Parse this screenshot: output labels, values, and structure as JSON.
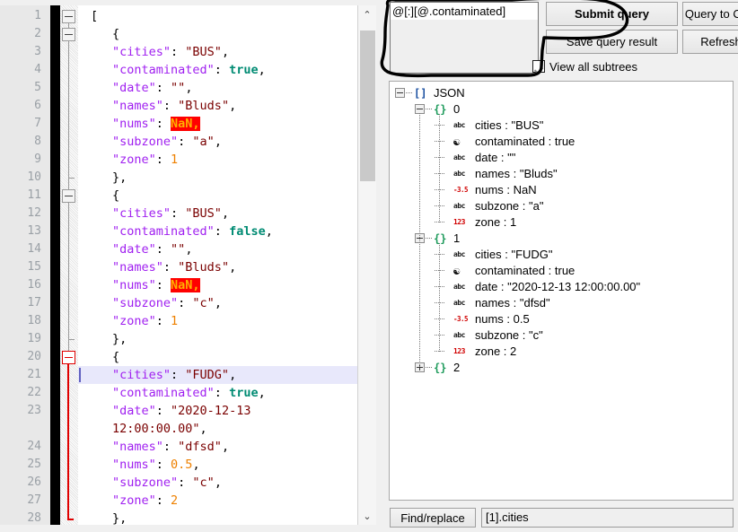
{
  "editor": {
    "name": "json-text-editor",
    "lines": [
      {
        "num": "1",
        "tokens": [
          {
            "t": "[",
            "c": "p"
          }
        ],
        "indent": 0
      },
      {
        "num": "2",
        "tokens": [
          {
            "t": "{",
            "c": "p"
          }
        ],
        "indent": 1
      },
      {
        "num": "3",
        "tokens": [
          {
            "t": "\"cities\"",
            "c": "k"
          },
          {
            "t": ": ",
            "c": "p"
          },
          {
            "t": "\"BUS\"",
            "c": "s"
          },
          {
            "t": ",",
            "c": "p"
          }
        ],
        "indent": 1
      },
      {
        "num": "4",
        "tokens": [
          {
            "t": "\"contaminated\"",
            "c": "k"
          },
          {
            "t": ": ",
            "c": "p"
          },
          {
            "t": "true",
            "c": "b"
          },
          {
            "t": ",",
            "c": "p"
          }
        ],
        "indent": 1
      },
      {
        "num": "5",
        "tokens": [
          {
            "t": "\"date\"",
            "c": "k"
          },
          {
            "t": ": ",
            "c": "p"
          },
          {
            "t": "\"\"",
            "c": "s"
          },
          {
            "t": ",",
            "c": "p"
          }
        ],
        "indent": 1
      },
      {
        "num": "6",
        "tokens": [
          {
            "t": "\"names\"",
            "c": "k"
          },
          {
            "t": ": ",
            "c": "p"
          },
          {
            "t": "\"Bluds\"",
            "c": "s"
          },
          {
            "t": ",",
            "c": "p"
          }
        ],
        "indent": 1
      },
      {
        "num": "7",
        "tokens": [
          {
            "t": "\"nums\"",
            "c": "k"
          },
          {
            "t": ": ",
            "c": "p"
          },
          {
            "t": "NaN,",
            "c": "nan"
          }
        ],
        "indent": 1
      },
      {
        "num": "8",
        "tokens": [
          {
            "t": "\"subzone\"",
            "c": "k"
          },
          {
            "t": ": ",
            "c": "p"
          },
          {
            "t": "\"a\"",
            "c": "s"
          },
          {
            "t": ",",
            "c": "p"
          }
        ],
        "indent": 1
      },
      {
        "num": "9",
        "tokens": [
          {
            "t": "\"zone\"",
            "c": "k"
          },
          {
            "t": ": ",
            "c": "p"
          },
          {
            "t": "1",
            "c": "n"
          }
        ],
        "indent": 1
      },
      {
        "num": "10",
        "tokens": [
          {
            "t": "},",
            "c": "p"
          }
        ],
        "indent": 1
      },
      {
        "num": "11",
        "tokens": [
          {
            "t": "{",
            "c": "p"
          }
        ],
        "indent": 1
      },
      {
        "num": "12",
        "tokens": [
          {
            "t": "\"cities\"",
            "c": "k"
          },
          {
            "t": ": ",
            "c": "p"
          },
          {
            "t": "\"BUS\"",
            "c": "s"
          },
          {
            "t": ",",
            "c": "p"
          }
        ],
        "indent": 1
      },
      {
        "num": "13",
        "tokens": [
          {
            "t": "\"contaminated\"",
            "c": "k"
          },
          {
            "t": ": ",
            "c": "p"
          },
          {
            "t": "false",
            "c": "b"
          },
          {
            "t": ",",
            "c": "p"
          }
        ],
        "indent": 1
      },
      {
        "num": "14",
        "tokens": [
          {
            "t": "\"date\"",
            "c": "k"
          },
          {
            "t": ": ",
            "c": "p"
          },
          {
            "t": "\"\"",
            "c": "s"
          },
          {
            "t": ",",
            "c": "p"
          }
        ],
        "indent": 1
      },
      {
        "num": "15",
        "tokens": [
          {
            "t": "\"names\"",
            "c": "k"
          },
          {
            "t": ": ",
            "c": "p"
          },
          {
            "t": "\"Bluds\"",
            "c": "s"
          },
          {
            "t": ",",
            "c": "p"
          }
        ],
        "indent": 1
      },
      {
        "num": "16",
        "tokens": [
          {
            "t": "\"nums\"",
            "c": "k"
          },
          {
            "t": ": ",
            "c": "p"
          },
          {
            "t": "NaN,",
            "c": "nan"
          }
        ],
        "indent": 1
      },
      {
        "num": "17",
        "tokens": [
          {
            "t": "\"subzone\"",
            "c": "k"
          },
          {
            "t": ": ",
            "c": "p"
          },
          {
            "t": "\"c\"",
            "c": "s"
          },
          {
            "t": ",",
            "c": "p"
          }
        ],
        "indent": 1
      },
      {
        "num": "18",
        "tokens": [
          {
            "t": "\"zone\"",
            "c": "k"
          },
          {
            "t": ": ",
            "c": "p"
          },
          {
            "t": "1",
            "c": "n"
          }
        ],
        "indent": 1
      },
      {
        "num": "19",
        "tokens": [
          {
            "t": "},",
            "c": "p"
          }
        ],
        "indent": 1
      },
      {
        "num": "20",
        "tokens": [
          {
            "t": "{",
            "c": "p"
          }
        ],
        "indent": 1
      },
      {
        "num": "21",
        "tokens": [
          {
            "t": "\"cities\"",
            "c": "k"
          },
          {
            "t": ": ",
            "c": "p"
          },
          {
            "t": "\"FUDG\"",
            "c": "s"
          },
          {
            "t": ",",
            "c": "p"
          }
        ],
        "indent": 1,
        "current": true
      },
      {
        "num": "22",
        "tokens": [
          {
            "t": "\"contaminated\"",
            "c": "k"
          },
          {
            "t": ": ",
            "c": "p"
          },
          {
            "t": "true",
            "c": "b"
          },
          {
            "t": ",",
            "c": "p"
          }
        ],
        "indent": 1
      },
      {
        "num": "23",
        "tokens": [
          {
            "t": "\"date\"",
            "c": "k"
          },
          {
            "t": ": ",
            "c": "p"
          },
          {
            "t": "\"2020-12-13",
            "c": "s"
          }
        ],
        "indent": 1
      },
      {
        "num": "",
        "tokens": [
          {
            "t": "12:00:00.00\"",
            "c": "s"
          },
          {
            "t": ",",
            "c": "p"
          }
        ],
        "indent": 1
      },
      {
        "num": "24",
        "tokens": [
          {
            "t": "\"names\"",
            "c": "k"
          },
          {
            "t": ": ",
            "c": "p"
          },
          {
            "t": "\"dfsd\"",
            "c": "s"
          },
          {
            "t": ",",
            "c": "p"
          }
        ],
        "indent": 1
      },
      {
        "num": "25",
        "tokens": [
          {
            "t": "\"nums\"",
            "c": "k"
          },
          {
            "t": ": ",
            "c": "p"
          },
          {
            "t": "0.5",
            "c": "n"
          },
          {
            "t": ",",
            "c": "p"
          }
        ],
        "indent": 1
      },
      {
        "num": "26",
        "tokens": [
          {
            "t": "\"subzone\"",
            "c": "k"
          },
          {
            "t": ": ",
            "c": "p"
          },
          {
            "t": "\"c\"",
            "c": "s"
          },
          {
            "t": ",",
            "c": "p"
          }
        ],
        "indent": 1
      },
      {
        "num": "27",
        "tokens": [
          {
            "t": "\"zone\"",
            "c": "k"
          },
          {
            "t": ": ",
            "c": "p"
          },
          {
            "t": "2",
            "c": "n"
          }
        ],
        "indent": 1
      },
      {
        "num": "28",
        "tokens": [
          {
            "t": "},",
            "c": "p"
          }
        ],
        "indent": 1
      }
    ],
    "scrollbar": {
      "up_arrow": "⌃",
      "down_arrow": "⌄"
    }
  },
  "query": {
    "value": "@[:][@.contaminated]",
    "placeholder": ""
  },
  "buttons": {
    "submit": "Submit query",
    "csv": "Query to CSV",
    "save": "Save query result",
    "refresh": "Refresh",
    "find_replace": "Find/replace"
  },
  "checkbox": {
    "label": "View all subtrees",
    "checked": true
  },
  "tree": {
    "nodes": [
      {
        "depth": 0,
        "expander": "minus",
        "icon": "[]",
        "icon_kind": "arr",
        "label": "JSON"
      },
      {
        "depth": 1,
        "expander": "minus",
        "icon": "{}",
        "icon_kind": "obj",
        "label": "0"
      },
      {
        "depth": 2,
        "expander": "none",
        "icon": "abc",
        "icon_kind": "str",
        "label": "cities : \"BUS\""
      },
      {
        "depth": 2,
        "expander": "none",
        "icon": "☯",
        "icon_kind": "bool",
        "label": "contaminated : true"
      },
      {
        "depth": 2,
        "expander": "none",
        "icon": "abc",
        "icon_kind": "str",
        "label": "date : \"\""
      },
      {
        "depth": 2,
        "expander": "none",
        "icon": "abc",
        "icon_kind": "str",
        "label": "names : \"Bluds\""
      },
      {
        "depth": 2,
        "expander": "none",
        "icon": "-3.5",
        "icon_kind": "flt",
        "label": "nums : NaN"
      },
      {
        "depth": 2,
        "expander": "none",
        "icon": "abc",
        "icon_kind": "str",
        "label": "subzone : \"a\""
      },
      {
        "depth": 2,
        "expander": "none",
        "icon": "123",
        "icon_kind": "int",
        "label": "zone : 1"
      },
      {
        "depth": 1,
        "expander": "minus",
        "icon": "{}",
        "icon_kind": "obj",
        "label": "1"
      },
      {
        "depth": 2,
        "expander": "none",
        "icon": "abc",
        "icon_kind": "str",
        "label": "cities : \"FUDG\""
      },
      {
        "depth": 2,
        "expander": "none",
        "icon": "☯",
        "icon_kind": "bool",
        "label": "contaminated : true"
      },
      {
        "depth": 2,
        "expander": "none",
        "icon": "abc",
        "icon_kind": "str",
        "label": "date : \"2020-12-13 12:00:00.00\""
      },
      {
        "depth": 2,
        "expander": "none",
        "icon": "abc",
        "icon_kind": "str",
        "label": "names : \"dfsd\""
      },
      {
        "depth": 2,
        "expander": "none",
        "icon": "-3.5",
        "icon_kind": "flt",
        "label": "nums : 0.5"
      },
      {
        "depth": 2,
        "expander": "none",
        "icon": "abc",
        "icon_kind": "str",
        "label": "subzone : \"c\""
      },
      {
        "depth": 2,
        "expander": "none",
        "icon": "123",
        "icon_kind": "int",
        "label": "zone : 2"
      },
      {
        "depth": 1,
        "expander": "plus",
        "icon": "{}",
        "icon_kind": "obj",
        "label": "2"
      }
    ]
  },
  "status": {
    "path": "[1].cities"
  },
  "colors": {
    "key": "#a020f0",
    "string": "#7a0000",
    "boolean": "#008b73",
    "number": "#ee8000",
    "error_bg": "#ff0000",
    "error_fg": "#ffb000",
    "fold_active": "#e00000",
    "current_line": "#e8e8fb"
  }
}
